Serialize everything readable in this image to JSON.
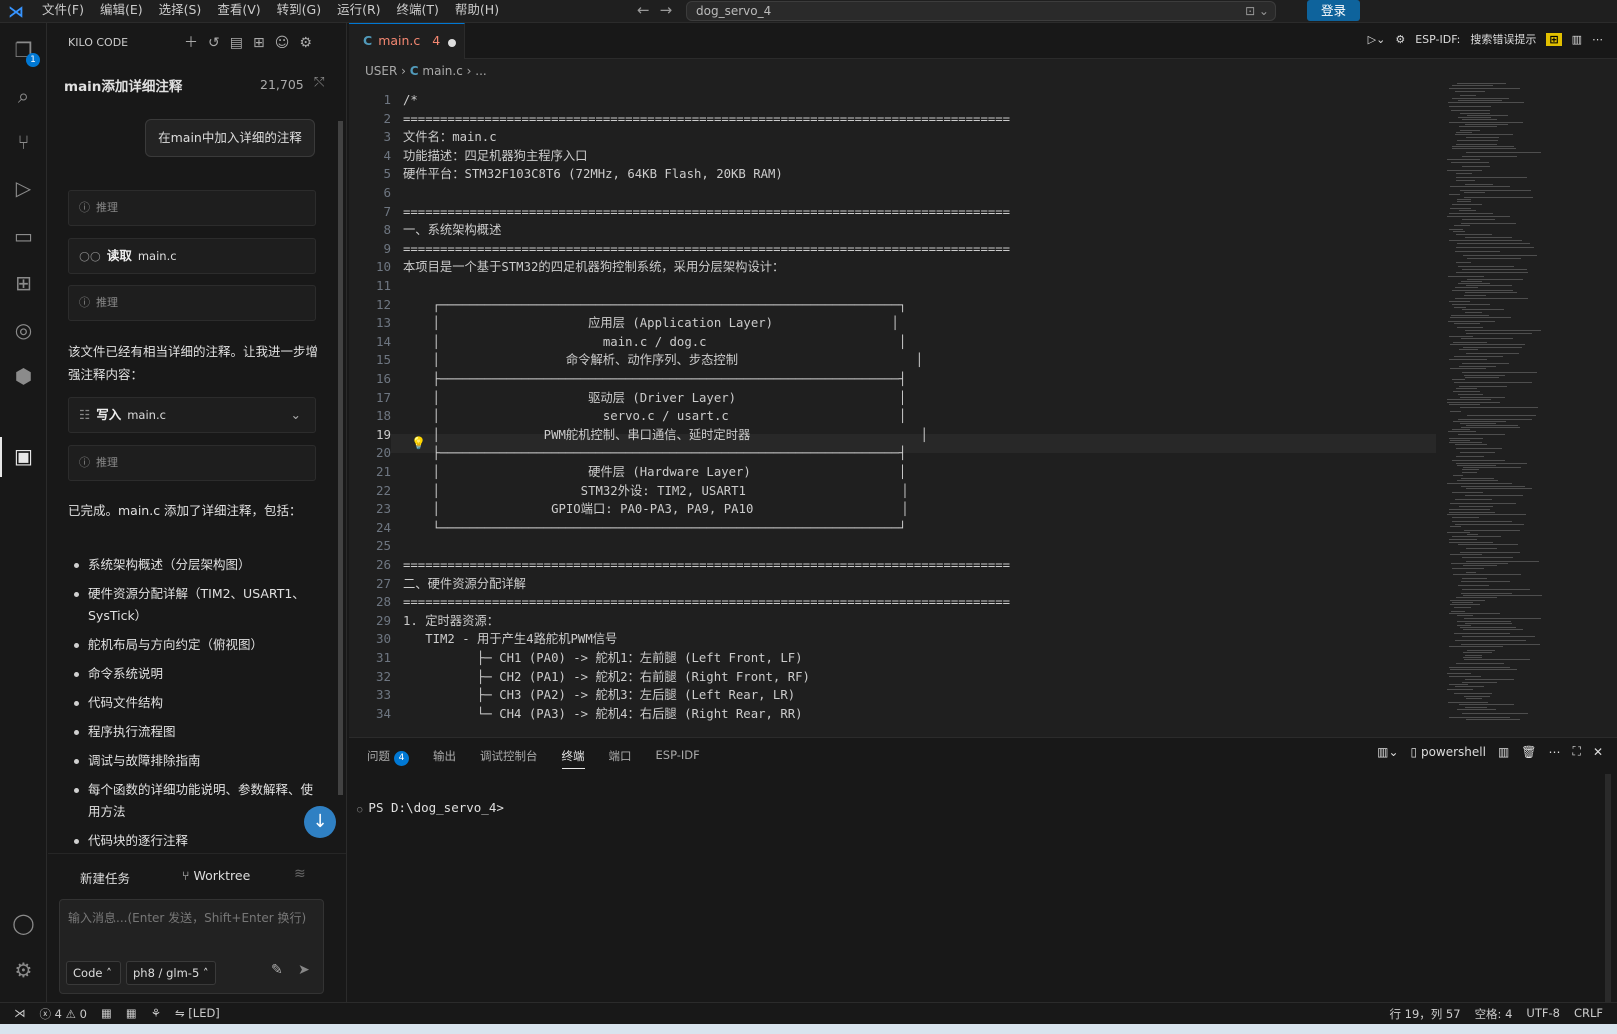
{
  "titlebar": {
    "menus": [
      "文件(F)",
      "编辑(E)",
      "选择(S)",
      "查看(V)",
      "转到(G)",
      "运行(R)",
      "终端(T)",
      "帮助(H)"
    ],
    "search": "dog_servo_4",
    "login": "登录"
  },
  "activity": {
    "explorer_badge": "1"
  },
  "sidebar": {
    "header": "KILO CODE",
    "task_title": "main添加详细注释",
    "tokens": "21,705",
    "user_message": "在main中加入详细的注释",
    "reasoning_label": "推理",
    "read_label": "读取",
    "read_file": "main.c",
    "paragraph1": "该文件已经有相当详细的注释。让我进一步增强注释内容：",
    "write_label": "写入",
    "write_file": "main.c",
    "done_text": "已完成。main.c 添加了详细注释，包括：",
    "bullets": [
      "系统架构概述（分层架构图）",
      "硬件资源分配详解（TIM2、USART1、SysTick）",
      "舵机布局与方向约定（俯视图）",
      "命令系统说明",
      "代码文件结构",
      "程序执行流程图",
      "调试与故障排除指南",
      "每个函数的详细功能说明、参数解释、使用方法",
      "代码块的逐行注释"
    ],
    "new_task": "新建任务",
    "worktree": "Worktree",
    "input_placeholder": "输入消息...(Enter 发送，Shift+Enter 换行)",
    "mode": "Code",
    "model": "ph8 / glm-5"
  },
  "editor": {
    "tab_name": "main.c",
    "tab_problems": "4",
    "esp_label": "ESP-IDF:",
    "esp_hint": "搜索错误提示",
    "breadcrumb": [
      "USER",
      "main.c",
      "..."
    ],
    "current_line": 19,
    "lines": [
      "/*",
      "==================================================================================",
      "文件名：main.c",
      "功能描述：四足机器狗主程序入口",
      "硬件平台：STM32F103C8T6 (72MHz, 64KB Flash, 20KB RAM)",
      "",
      "==================================================================================",
      "一、系统架构概述",
      "==================================================================================",
      "本项目是一个基于STM32的四足机器狗控制系统，采用分层架构设计：",
      "",
      "    ┌──────────────────────────────────────────────────────────────┐",
      "    │                    应用层 (Application Layer)                │",
      "    │                      main.c / dog.c                          │",
      "    │                 命令解析、动作序列、步态控制                        │",
      "    ├──────────────────────────────────────────────────────────────┤",
      "    │                    驱动层 (Driver Layer)                      │",
      "    │                      servo.c / usart.c                       │",
      "    │              PWM舵机控制、串口通信、延时定时器                       │",
      "    ├──────────────────────────────────────────────────────────────┤",
      "    │                    硬件层 (Hardware Layer)                    │",
      "    │                   STM32外设: TIM2, USART1                     │",
      "    │               GPIO端口: PA0-PA3, PA9, PA10                    │",
      "    └──────────────────────────────────────────────────────────────┘",
      "",
      "==================================================================================",
      "二、硬件资源分配详解",
      "==================================================================================",
      "1. 定时器资源：",
      "   TIM2 - 用于产生4路舵机PWM信号",
      "          ├─ CH1 (PA0) -> 舵机1：左前腿 (Left Front, LF)",
      "          ├─ CH2 (PA1) -> 舵机2：右前腿 (Right Front, RF)",
      "          ├─ CH3 (PA2) -> 舵机3：左后腿 (Left Rear, LR)",
      "          └─ CH4 (PA3) -> 舵机4：右后腿 (Right Rear, RR)"
    ]
  },
  "panel": {
    "tabs": [
      "问题",
      "输出",
      "调试控制台",
      "终端",
      "端口",
      "ESP-IDF"
    ],
    "problems_count": "4",
    "shell": "powershell",
    "prompt": "PS D:\\dog_servo_4>"
  },
  "status": {
    "errors": "4",
    "warnings": "0",
    "led": "[LED]",
    "position": "行 19，列 57",
    "spaces": "空格: 4",
    "encoding": "UTF-8",
    "eol": "CRLF"
  }
}
